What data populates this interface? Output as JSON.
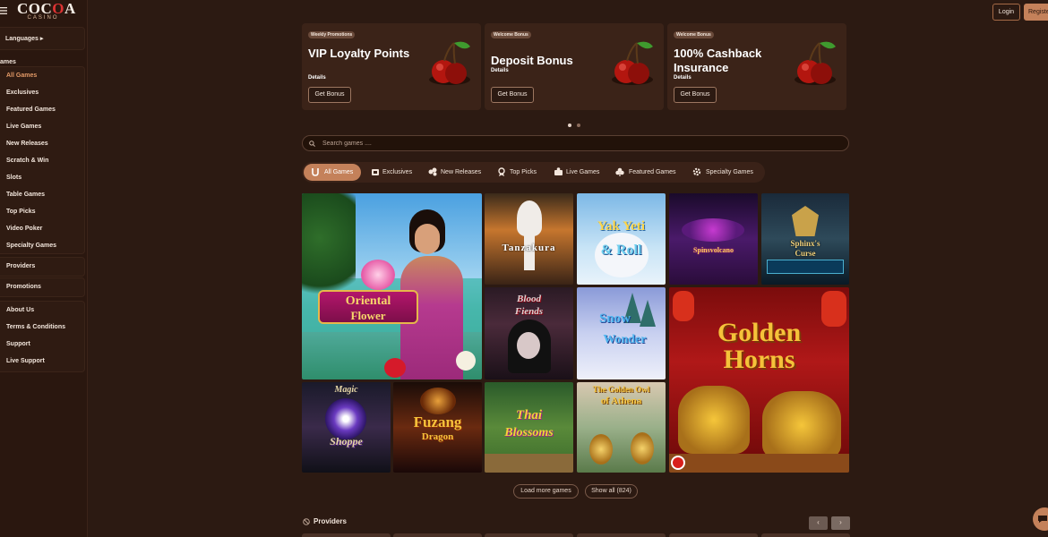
{
  "logo": {
    "text_main_pre": "COC",
    "text_main_o": "O",
    "text_main_post": "A",
    "text_sub": "CASINO"
  },
  "sidebar": {
    "languages_label": "Languages",
    "games_group_label": "ames",
    "games_items": [
      {
        "label": "All Games",
        "active": true
      },
      {
        "label": "Exclusives"
      },
      {
        "label": "Featured Games"
      },
      {
        "label": "Live Games"
      },
      {
        "label": "New Releases"
      },
      {
        "label": "Scratch & Win"
      },
      {
        "label": "Slots"
      },
      {
        "label": "Table Games"
      },
      {
        "label": "Top Picks"
      },
      {
        "label": "Video Poker"
      },
      {
        "label": "Specialty Games"
      }
    ],
    "providers_label": "Providers",
    "promotions_label": "Promotions",
    "info_items": [
      {
        "label": "About Us"
      },
      {
        "label": "Terms & Conditions"
      },
      {
        "label": "Support"
      },
      {
        "label": "Live Support"
      }
    ]
  },
  "topbar": {
    "login_label": "Login",
    "register_label": "Registe"
  },
  "promos": [
    {
      "tag": "Weekly Promotions",
      "title": "VIP Loyalty Points",
      "details": "Details",
      "button": "Get Bonus"
    },
    {
      "tag": "Welcome Bonus",
      "title": "Deposit Bonus",
      "details": "Details",
      "button": "Get Bonus"
    },
    {
      "tag": "Welcome Bonus",
      "title": "100% Cashback Insurance",
      "details": "Details",
      "button": "Get Bonus"
    }
  ],
  "carousel": {
    "page_count": 2,
    "active_page": 1
  },
  "search": {
    "placeholder": "Search games ....",
    "value": ""
  },
  "tabs": [
    {
      "label": "All Games",
      "icon": "horseshoe-icon",
      "active": true
    },
    {
      "label": "Exclusives",
      "icon": "exclusive-icon"
    },
    {
      "label": "New Releases",
      "icon": "new-release-icon"
    },
    {
      "label": "Top Picks",
      "icon": "trophy-icon"
    },
    {
      "label": "Live Games",
      "icon": "live-dealer-icon"
    },
    {
      "label": "Featured Games",
      "icon": "club-icon"
    },
    {
      "label": "Specialty Games",
      "icon": "gear-icon"
    }
  ],
  "games": [
    {
      "title_line1": "Oriental",
      "title_line2": "Flower"
    },
    {
      "title_line1": "Tanzakura",
      "title_line2": ""
    },
    {
      "title_line1": "Yak Yeti",
      "title_line2": "& Roll"
    },
    {
      "title_line1": "Spinsvolcano",
      "title_line2": ""
    },
    {
      "title_line1": "Sphinx's",
      "title_line2": "Curse"
    },
    {
      "title_line1": "Blood",
      "title_line2": "Fiends"
    },
    {
      "title_line1": "Snow",
      "title_line2": "Wonder"
    },
    {
      "title_line1": "Golden",
      "title_line2": "Horns"
    },
    {
      "title_line1": "Magic",
      "title_line2": "Shoppe"
    },
    {
      "title_line1": "Fuzang",
      "title_line2": "Dragon"
    },
    {
      "title_line1": "Thai",
      "title_line2": "Blossoms"
    },
    {
      "title_line1": "The Golden Owl",
      "title_line2": "of Athena"
    }
  ],
  "load_more_label": "Load more games",
  "show_all_label": "Show all (824)",
  "providers_section": {
    "title": "Providers",
    "prev": "‹",
    "next": "›"
  },
  "colors": {
    "background": "#2c1a12",
    "accent": "#c4815a",
    "active_text": "#e39a67"
  }
}
